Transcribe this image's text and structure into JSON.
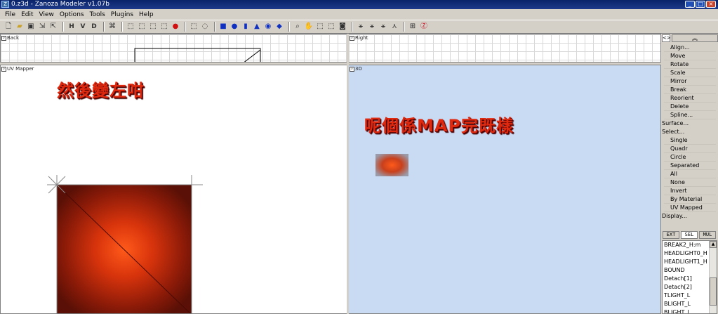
{
  "window": {
    "title": "0.z3d - Zanoza Modeler v1.07b",
    "app_icon": "z3d-icon",
    "controls": [
      "minimize",
      "maximize",
      "close"
    ]
  },
  "menu": [
    "File",
    "Edit",
    "View",
    "Options",
    "Tools",
    "Plugins",
    "Help"
  ],
  "toolbar": {
    "groups": [
      [
        "new-file-icon",
        "open-folder-icon",
        "save-disk-icon",
        "import-icon",
        "export-icon"
      ],
      [
        "H",
        "V",
        "D"
      ],
      [
        "network-icon"
      ],
      [
        "cube-1-icon",
        "cube-2-icon",
        "cube-3-icon",
        "cube-4-icon",
        "red-sphere-icon"
      ],
      [
        "select-rect-icon",
        "select-circle-icon"
      ],
      [
        "box-icon",
        "sphere-icon",
        "cylinder-icon",
        "cone-icon",
        "torus-icon",
        "gem-icon"
      ],
      [
        "zoom-icon",
        "pan-hand-icon",
        "ortho-cube-icon",
        "window-cube-icon",
        "camera-icon"
      ],
      [
        "bone-1-icon",
        "bone-2-icon",
        "bone-3-icon",
        "bone-4-icon",
        "uv-icon",
        "z-logo-icon"
      ]
    ],
    "letter_buttons": {
      "h": "H",
      "v": "V",
      "d": "D"
    }
  },
  "viewports": {
    "back": {
      "label": "Back"
    },
    "right": {
      "label": "Right"
    },
    "uv": {
      "label": "UV Mapper",
      "overlay_text": "然後變左咁"
    },
    "view3d": {
      "label": "3D",
      "overlay_text": "呢個係MAP完既樣"
    }
  },
  "side_panel": {
    "pin_label": "<>",
    "collapse_label": "︽",
    "commands": [
      {
        "label": "Align...",
        "section": false
      },
      {
        "label": "Move",
        "section": false
      },
      {
        "label": "Rotate",
        "section": false
      },
      {
        "label": "Scale",
        "section": false
      },
      {
        "label": "Mirror",
        "section": false
      },
      {
        "label": "Break",
        "section": false
      },
      {
        "label": "Reorient",
        "section": false
      },
      {
        "label": "Delete",
        "section": false
      },
      {
        "label": "Spline...",
        "section": false
      },
      {
        "label": "Surface...",
        "section": true
      },
      {
        "label": "Select...",
        "section": true
      },
      {
        "label": "Single",
        "section": false
      },
      {
        "label": "Quadr",
        "section": false
      },
      {
        "label": "Circle",
        "section": false
      },
      {
        "label": "Separated",
        "section": false
      },
      {
        "label": "All",
        "section": false
      },
      {
        "label": "None",
        "section": false
      },
      {
        "label": "Invert",
        "section": false
      },
      {
        "label": "By Material",
        "section": false
      },
      {
        "label": "UV Mapped",
        "section": false
      },
      {
        "label": "Display...",
        "section": true
      }
    ],
    "tabs": [
      {
        "label": "EXT",
        "active": false
      },
      {
        "label": "SEL",
        "active": true
      },
      {
        "label": "MUL",
        "active": false
      }
    ],
    "objects": [
      "BREAK2_H:m",
      "HEADLIGHT0_H",
      "HEADLIGHT1_H",
      "BOUND",
      "Detach[1]",
      "Detach[2]",
      "TLIGHT_L",
      "BLIGHT_L",
      "BLIGHT_L"
    ]
  }
}
